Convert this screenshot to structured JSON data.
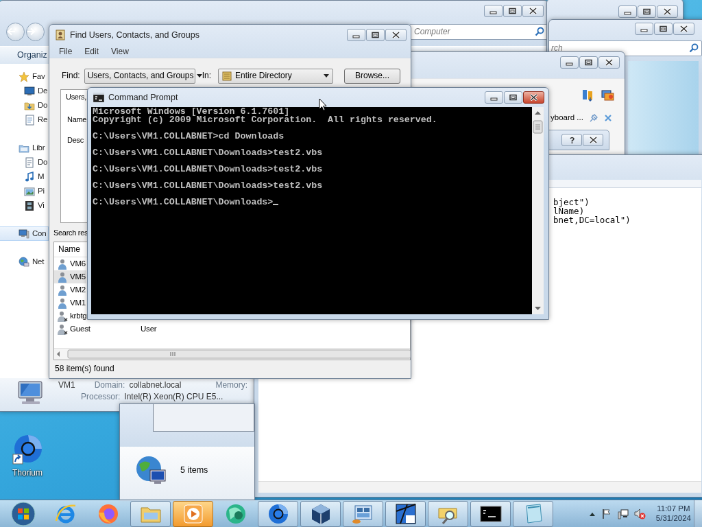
{
  "explorer": {
    "search_placeholder": "Computer",
    "toolbar_label": "Organiz",
    "sidebar": [
      {
        "label": "Fav",
        "kind": "star",
        "selected": false,
        "children": [
          {
            "label": "De",
            "kind": "desktop",
            "selected": false
          },
          {
            "label": "Do",
            "kind": "downloads",
            "selected": false
          },
          {
            "label": "Re",
            "kind": "recent",
            "selected": false
          }
        ]
      },
      {
        "label": "Libr",
        "kind": "library",
        "selected": false,
        "children": [
          {
            "label": "Do",
            "kind": "document",
            "selected": false
          },
          {
            "label": "M",
            "kind": "music",
            "selected": false
          },
          {
            "label": "Pi",
            "kind": "pictures",
            "selected": false
          },
          {
            "label": "Vi",
            "kind": "video",
            "selected": false
          }
        ]
      },
      {
        "label": "Con",
        "kind": "computer",
        "selected": true
      },
      {
        "label": "Net",
        "kind": "network",
        "selected": false
      }
    ],
    "details": {
      "name": "VM1",
      "domain_label": "Domain:",
      "domain": "collabnet.local",
      "memory_label": "Memory:",
      "processor_label": "Processor:",
      "processor": "Intel(R) Xeon(R) CPU E5..."
    }
  },
  "window_b": {
    "search_placeholder": "rch"
  },
  "window_c": {
    "toolbar_label": "yboard ..."
  },
  "editor": {
    "code_lines": [
      "bject\")",
      "lName)",
      "bnet,DC=local\")"
    ]
  },
  "folder_window": {
    "status": "5 items"
  },
  "find_dialog": {
    "title": "Find Users, Contacts, and Groups",
    "menu": [
      "File",
      "Edit",
      "View"
    ],
    "find_label": "Find:",
    "find_value": "Users, Contacts, and Groups",
    "in_label": "In:",
    "in_value": "Entire Directory",
    "browse_button": "Browse...",
    "tab": "Users,",
    "fields": [
      "Name",
      "Desc"
    ],
    "results_label": "Search res",
    "columns": [
      "Name"
    ],
    "rows": [
      {
        "name": "VM6",
        "kind": "user",
        "selected": false
      },
      {
        "name": "VM5",
        "kind": "user",
        "selected": true
      },
      {
        "name": "VM2",
        "kind": "user",
        "selected": false
      },
      {
        "name": "VM1",
        "kind": "user",
        "selected": false
      },
      {
        "name": "krbtg",
        "kind": "disabled-user",
        "selected": false
      },
      {
        "name": "Guest",
        "kind": "disabled-user",
        "type": "User",
        "selected": false
      }
    ],
    "status": "58 item(s) found"
  },
  "command_prompt": {
    "title": "Command Prompt",
    "header": [
      "Microsoft Windows [Version 6.1.7601]",
      "Copyright (c) 2009 Microsoft Corporation.  All rights reserved."
    ],
    "commands": [
      "C:\\Users\\VM1.COLLABNET>cd Downloads",
      "C:\\Users\\VM1.COLLABNET\\Downloads>test2.vbs",
      "C:\\Users\\VM1.COLLABNET\\Downloads>test2.vbs",
      "C:\\Users\\VM1.COLLABNET\\Downloads>test2.vbs"
    ],
    "prompt": "C:\\Users\\VM1.COLLABNET\\Downloads>"
  },
  "desktop_icons": [
    {
      "label": "Thorium"
    }
  ],
  "taskbar": {
    "items": [
      {
        "kind": "start",
        "open": false,
        "highlighted": false
      },
      {
        "kind": "ie",
        "open": false,
        "highlighted": false
      },
      {
        "kind": "firefox",
        "open": false,
        "highlighted": false
      },
      {
        "kind": "explorer",
        "open": true,
        "highlighted": false
      },
      {
        "kind": "media",
        "open": true,
        "highlighted": true
      },
      {
        "kind": "green-globe",
        "open": false,
        "highlighted": false
      },
      {
        "kind": "thorium",
        "open": true,
        "highlighted": false
      },
      {
        "kind": "cube",
        "open": true,
        "highlighted": false
      },
      {
        "kind": "network-tool",
        "open": true,
        "highlighted": false
      },
      {
        "kind": "nt",
        "open": true,
        "highlighted": false
      },
      {
        "kind": "search-folder",
        "open": true,
        "highlighted": false
      },
      {
        "kind": "console",
        "open": true,
        "highlighted": false
      },
      {
        "kind": "notepad",
        "open": true,
        "highlighted": false
      }
    ],
    "time": "11:07 PM",
    "date": "5/31/2024"
  }
}
